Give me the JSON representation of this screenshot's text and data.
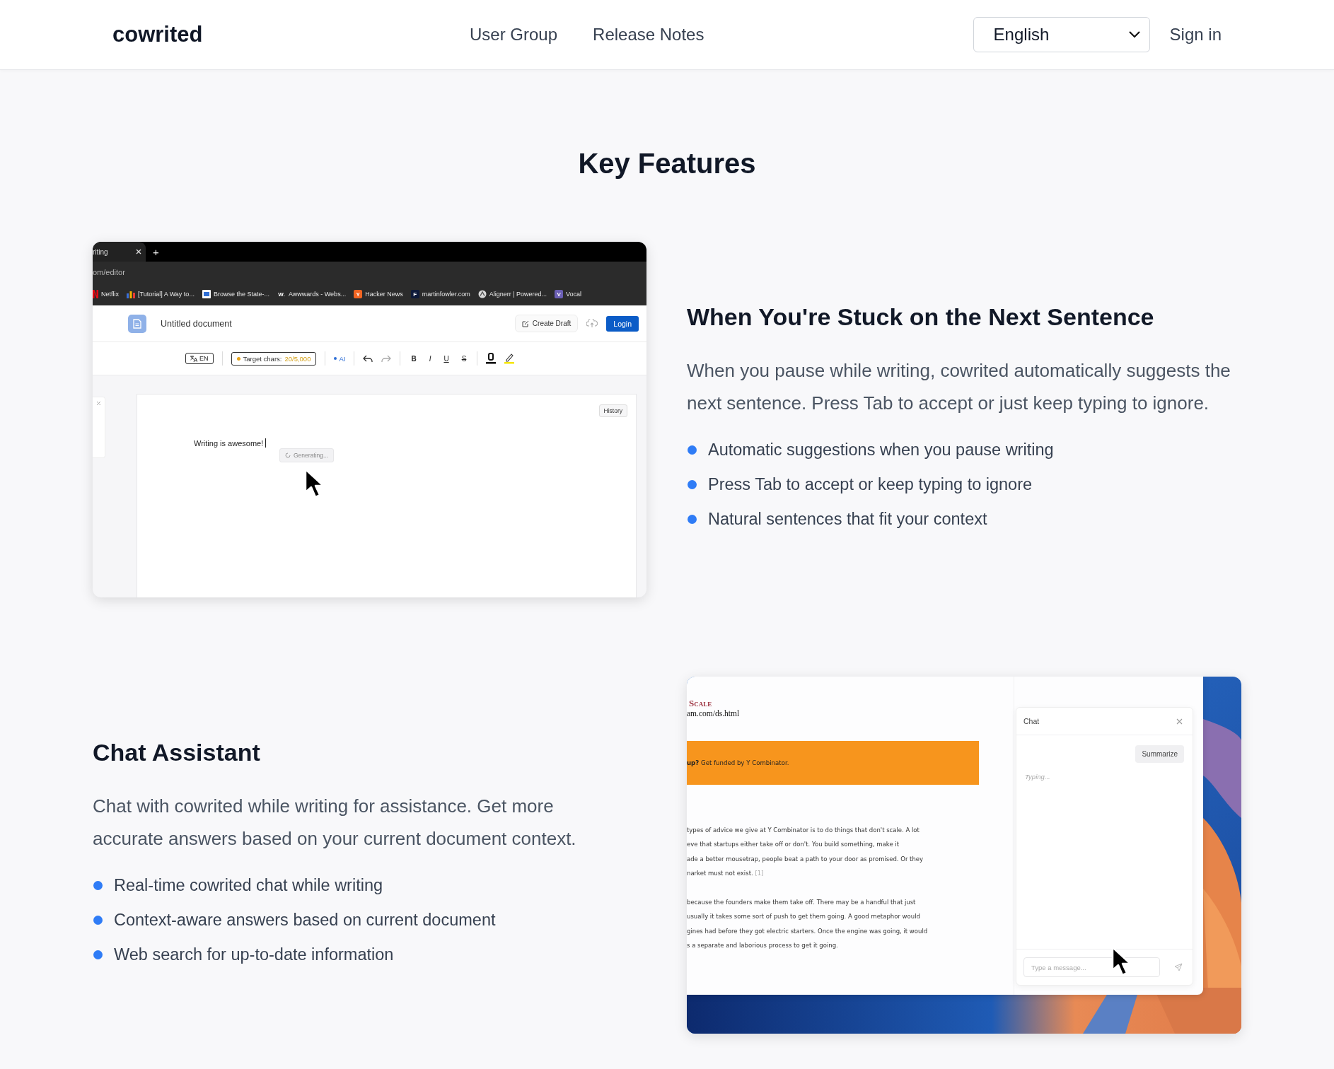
{
  "header": {
    "logo": "cowrited",
    "nav": [
      {
        "label": "User Group"
      },
      {
        "label": "Release Notes"
      }
    ],
    "language": "English",
    "sign_in": "Sign in"
  },
  "title": "Key Features",
  "features": [
    {
      "heading": "When You're Stuck on the Next Sentence",
      "description": "When you pause while writing, cowrited automatically suggests the next sentence. Press Tab to accept or just keep typing to ignore.",
      "bullets": [
        "Automatic suggestions when you pause writing",
        "Press Tab to accept or keep typing to ignore",
        "Natural sentences that fit your context"
      ],
      "screenshot": {
        "kind": "editor",
        "tab_title": "riting",
        "new_tab": "+",
        "url": "om/editor",
        "bookmarks": [
          {
            "label": "Netflix",
            "kind": "netflix",
            "color": "#e50914"
          },
          {
            "label": "[Tutorial] A Way to...",
            "kind": "bars",
            "color": "#3b6fd8"
          },
          {
            "label": "Browse the State-...",
            "kind": "frame",
            "color": "#2f6fd6"
          },
          {
            "label": "Awwwards - Webs...",
            "kind": "letter",
            "icon": "W.",
            "color": "#2b2b2b"
          },
          {
            "label": "Hacker News",
            "kind": "letter",
            "icon": "Y",
            "color": "#f26522"
          },
          {
            "label": "martinfowler.com",
            "kind": "letter",
            "icon": "F",
            "color": "#0e1a3a"
          },
          {
            "label": "Alignerr | Powered...",
            "kind": "ring",
            "color": "#d9d9d9"
          },
          {
            "label": "Vocal",
            "kind": "letter",
            "icon": "V",
            "color": "#6b5fb5"
          }
        ],
        "doc_title": "Untitled document",
        "create_draft": "Create Draft",
        "login": "Login",
        "language": "EN",
        "target_label": "Target chars:",
        "target_value": "20/5,000",
        "ai": "AI",
        "format_buttons": [
          {
            "label": "B",
            "kind": "bold"
          },
          {
            "label": "I",
            "kind": "italic"
          },
          {
            "label": "U",
            "kind": "underline"
          },
          {
            "label": "S",
            "kind": "strike"
          }
        ],
        "history": "History",
        "text": "Writing is awesome!",
        "generating": "Generating..."
      }
    },
    {
      "heading": "Chat Assistant",
      "description": "Chat with cowrited while writing for assistance. Get more accurate answers based on your current document context.",
      "bullets": [
        "Real-time cowrited chat while writing",
        "Context-aware answers based on current document",
        "Web search for up-to-date information"
      ],
      "screenshot": {
        "kind": "chat",
        "page_title": "Scale",
        "page_url": "am.com/ds.html",
        "banner": "**up?** Get funded by Y Combinator.",
        "paragraphs": [
          {
            "lines": [
              "types of advice we give at Y Combinator is to do things that don't scale. A lot",
              "eve that startups either take off or don't. You build something, make it",
              "ade a better mousetrap, people beat a path to your door as promised. Or they",
              "narket must not exist."
            ],
            "footnote": "[1]"
          },
          {
            "lines": [
              "because the founders make them take off. There may be a handful that just",
              "usually it takes some sort of push to get them going. A good metaphor would",
              "gines had before they got electric starters. Once the engine was going, it would",
              "s a separate and laborious process to get it going."
            ]
          }
        ],
        "chat": {
          "title": "Chat",
          "suggestion": "Summarize",
          "status": "Typing...",
          "placeholder": "Type a message..."
        }
      }
    }
  ]
}
